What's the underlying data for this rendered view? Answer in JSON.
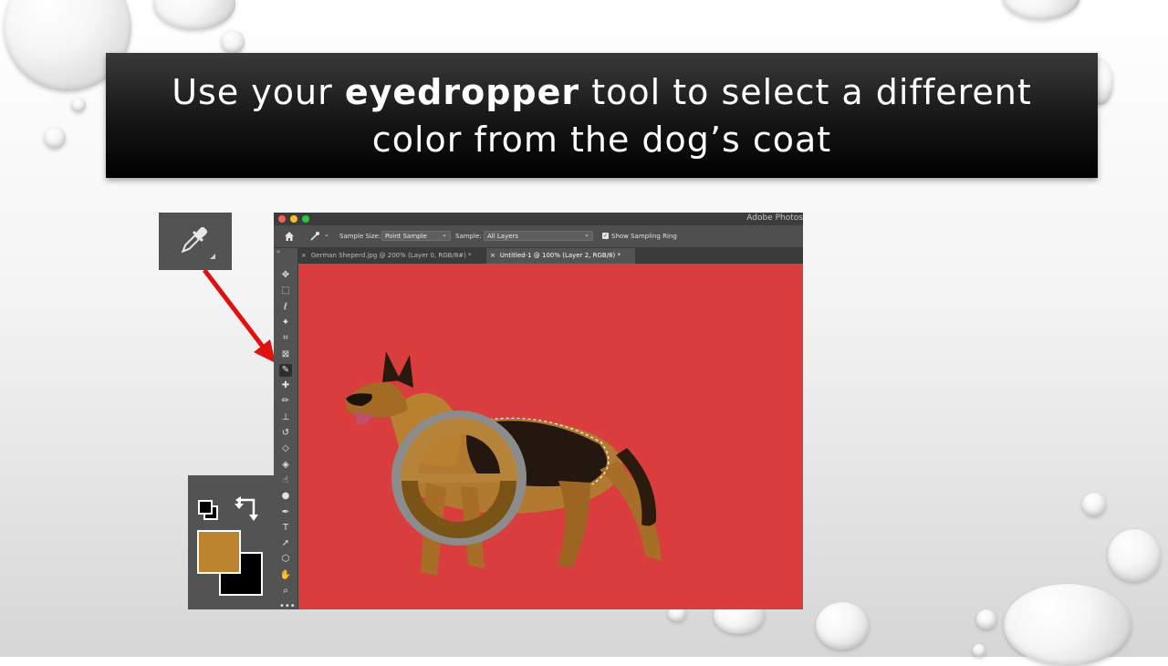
{
  "slide": {
    "title_pre": "Use your ",
    "title_bold": "eyedropper",
    "title_post": " tool to select a different color from the dog’s coat"
  },
  "photoshop": {
    "app_title": "Adobe Photos",
    "options_bar": {
      "sample_size_label": "Sample Size:",
      "sample_size_value": "Point Sample",
      "sample_label": "Sample:",
      "sample_value": "All Layers",
      "show_ring_label": "Show Sampling Ring",
      "show_ring_checked": true
    },
    "tabs": [
      {
        "label": "German Sheperd.jpg @ 200% (Layer 0, RGB/8#) *",
        "active": false
      },
      {
        "label": "Untitled-1 @ 100% (Layer 2, RGB/8) *",
        "active": true
      }
    ],
    "tools": [
      "move-icon",
      "marquee-icon",
      "lasso-icon",
      "magic-wand-icon",
      "crop-icon",
      "frame-icon",
      "eyedropper-icon",
      "healing-icon",
      "brush-icon",
      "stamp-icon",
      "history-brush-icon",
      "eraser-icon",
      "paint-bucket-icon",
      "smudge-icon",
      "dodge-icon",
      "pen-icon",
      "type-icon",
      "path-select-icon",
      "shape-icon",
      "hand-icon",
      "zoom-icon",
      "more-icon"
    ],
    "selected_tool": "eyedropper-icon",
    "tool_glyphs": {
      "type-icon": "T",
      "more-icon": "•••"
    },
    "canvas_color": "#d93d3d"
  },
  "colors": {
    "foreground": "#bd8430",
    "background": "#000000",
    "sampling_ring_top": "#b5843a",
    "sampling_ring_bottom": "#7a5416",
    "sampling_ring_outer": "#8c8c8c",
    "arrow": "#e01010"
  }
}
